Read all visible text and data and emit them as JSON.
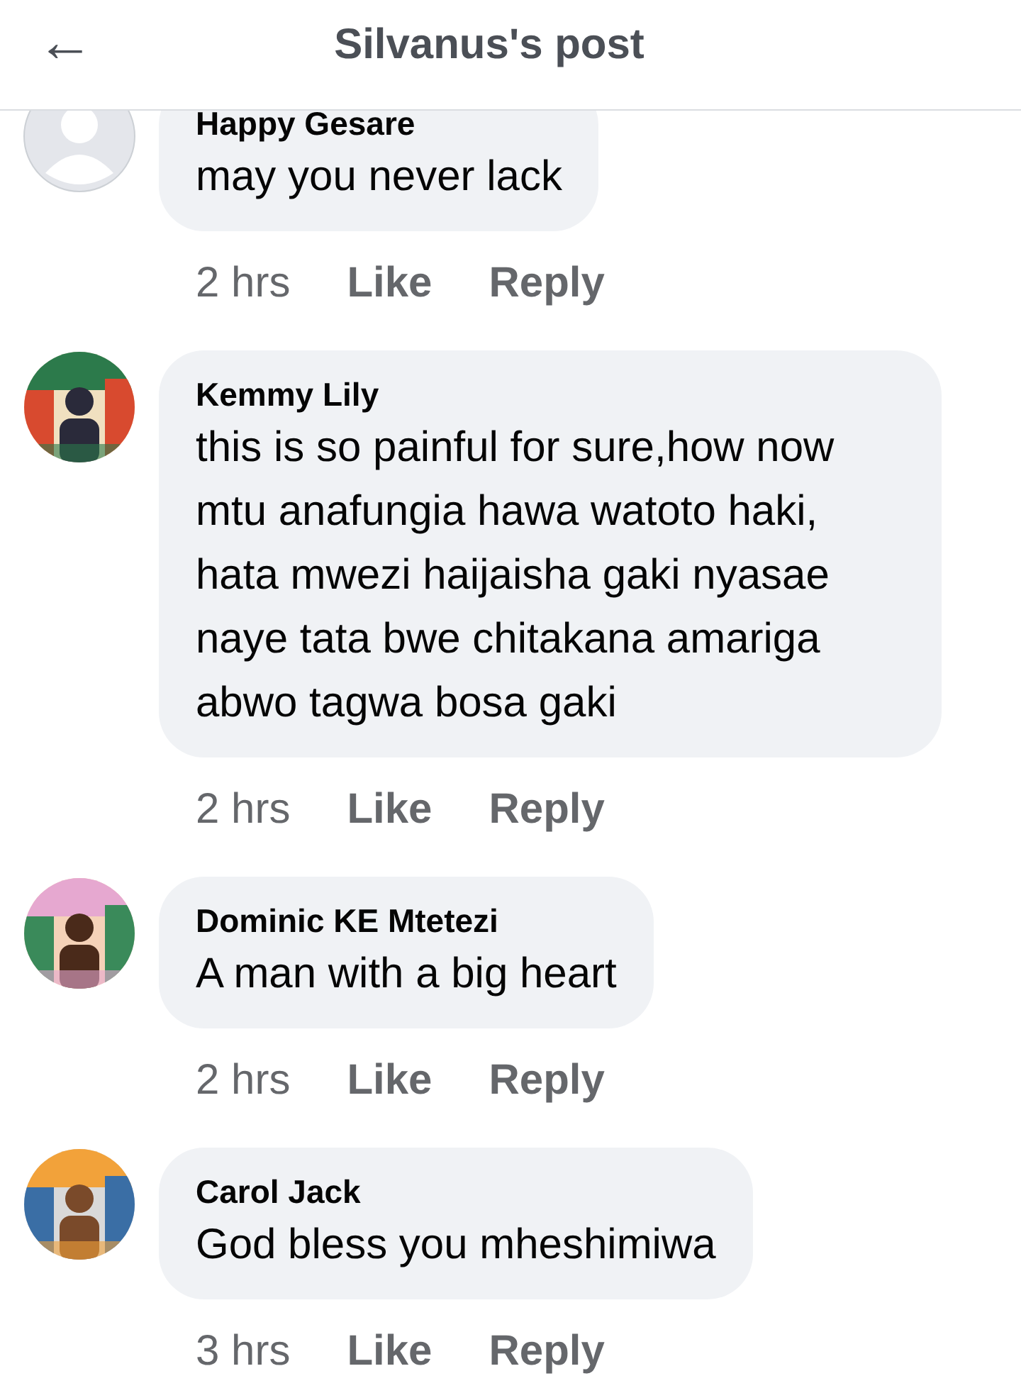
{
  "header": {
    "back": "←",
    "title": "Silvanus's post"
  },
  "comments": [
    {
      "name": "Happy Gesare",
      "text": "may you never lack",
      "time": "2 hrs",
      "like": "Like",
      "reply": "Reply",
      "avatar": {
        "kind": "default"
      }
    },
    {
      "name": "Kemmy Lily",
      "text": "this is so painful for sure,how now mtu anafungia hawa watoto haki, hata mwezi haijaisha gaki nyasae naye tata bwe chitakana amariga abwo tagwa bosa gaki",
      "time": "2 hrs",
      "like": "Like",
      "reply": "Reply"
    },
    {
      "name": "Dominic KE Mtetezi",
      "text": "A man with a big heart",
      "time": "2 hrs",
      "like": "Like",
      "reply": "Reply"
    },
    {
      "name": "Carol Jack",
      "text": "God bless you mheshimiwa",
      "time": "3 hrs",
      "like": "Like",
      "reply": "Reply"
    }
  ]
}
